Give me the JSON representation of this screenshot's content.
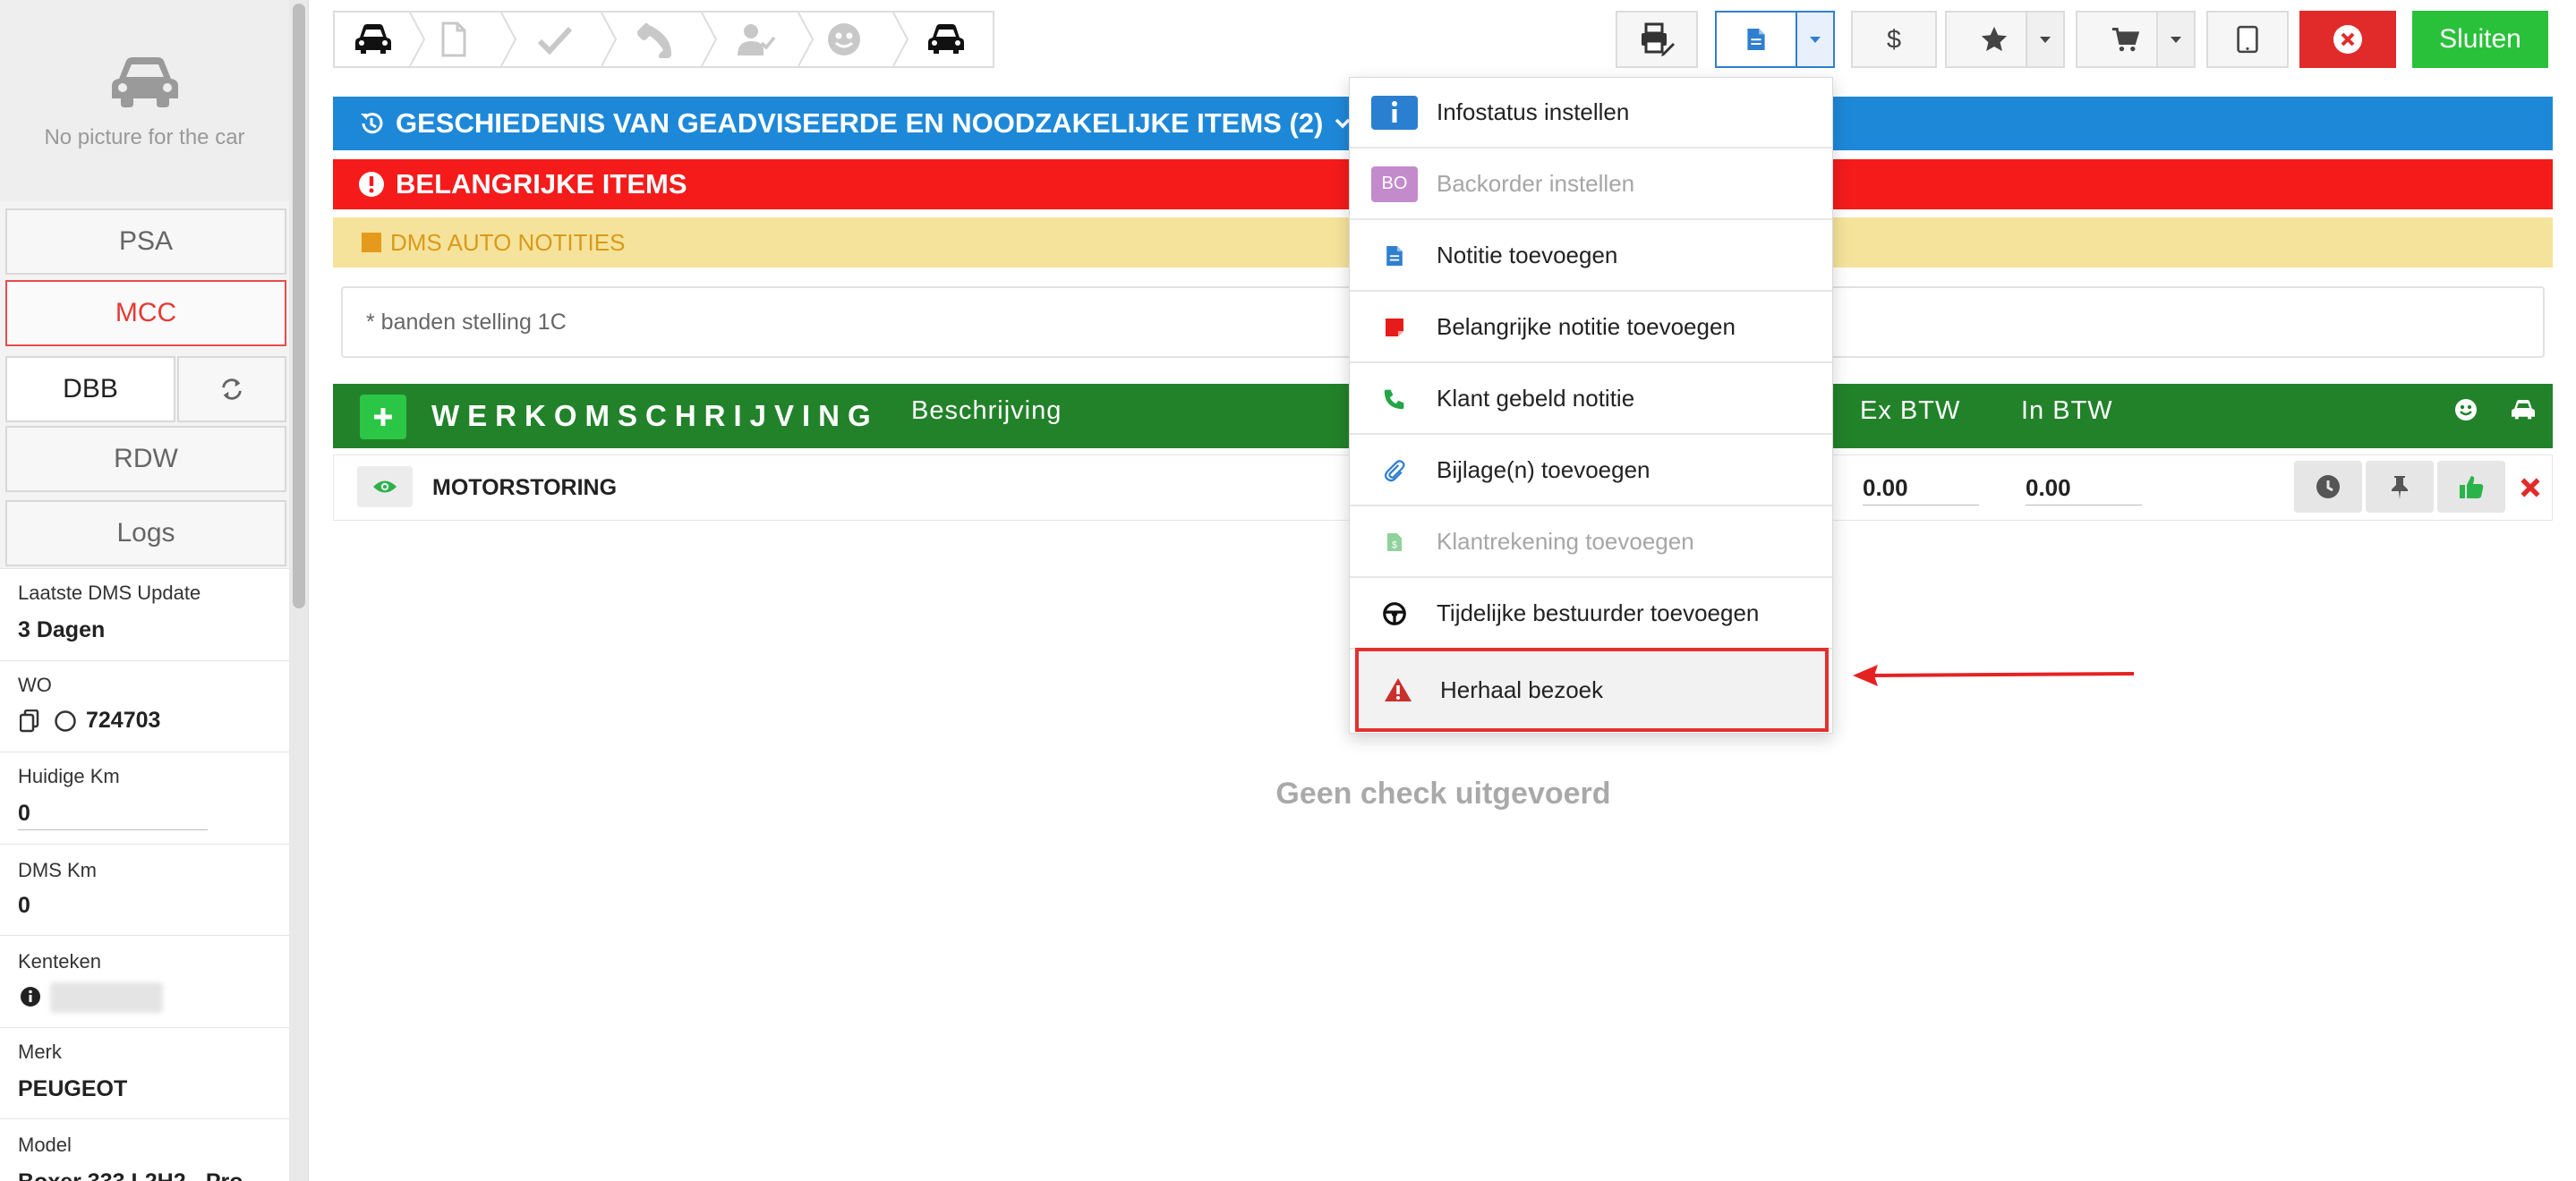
{
  "sidebar": {
    "photo_placeholder": "No picture for the car",
    "buttons": {
      "psa": "PSA",
      "mcc": "MCC",
      "dbb": "DBB",
      "rdw": "RDW",
      "logs": "Logs"
    },
    "info": [
      {
        "label": "Laatste DMS Update",
        "value": "3 Dagen"
      },
      {
        "label": "WO",
        "value": "724703"
      },
      {
        "label": "Huidige Km",
        "value": "0"
      },
      {
        "label": "DMS Km",
        "value": "0"
      },
      {
        "label": "Kenteken",
        "value": ""
      },
      {
        "label": "Merk",
        "value": "PEUGEOT"
      },
      {
        "label": "Model",
        "value": "Boxer 333 L2H2 - Pro"
      }
    ]
  },
  "toolbar": {
    "close_label": "Sluiten"
  },
  "history_bar": {
    "title": "GESCHIEDENIS VAN GEADVISEERDE EN NOODZAKELIJKE ITEMS (2)"
  },
  "important_bar": {
    "title": "BELANGRIJKE ITEMS"
  },
  "dms_notes": {
    "title": "DMS AUTO NOTITIES",
    "text": "* banden stelling 1C"
  },
  "work_header": {
    "title": "WERKOMSCHRIJVING",
    "col_description": "Beschrijving",
    "col_ex_btw": "Ex BTW",
    "col_in_btw": "In BTW"
  },
  "tasks": [
    {
      "name": "MOTORSTORING",
      "ex_btw": "0.00",
      "in_btw": "0.00"
    }
  ],
  "empty_message": "Geen check uitgevoerd",
  "menu": {
    "items": [
      {
        "label": "Infostatus instellen",
        "icon": "info-icon"
      },
      {
        "label": "Backorder instellen",
        "icon": "bo-badge",
        "badge": "BO"
      },
      {
        "label": "Notitie toevoegen",
        "icon": "document-icon"
      },
      {
        "label": "Belangrijke notitie toevoegen",
        "icon": "red-note-icon"
      },
      {
        "label": "Klant gebeld notitie",
        "icon": "phone-icon"
      },
      {
        "label": "Bijlage(n) toevoegen",
        "icon": "paperclip-icon"
      },
      {
        "label": "Klantrekening toevoegen",
        "icon": "invoice-icon"
      },
      {
        "label": "Tijdelijke bestuurder toevoegen",
        "icon": "steering-wheel-icon"
      },
      {
        "label": "Herhaal bezoek",
        "icon": "warning-icon"
      }
    ]
  },
  "colors": {
    "blue_bar": "#1e88d8",
    "red_bar": "#f51b1b",
    "yellow_bar": "#f6e39b",
    "green_bar": "#22822a",
    "close_button": "#29c13a",
    "cancel_button": "#e12b2b",
    "highlight_border": "#e53030"
  }
}
